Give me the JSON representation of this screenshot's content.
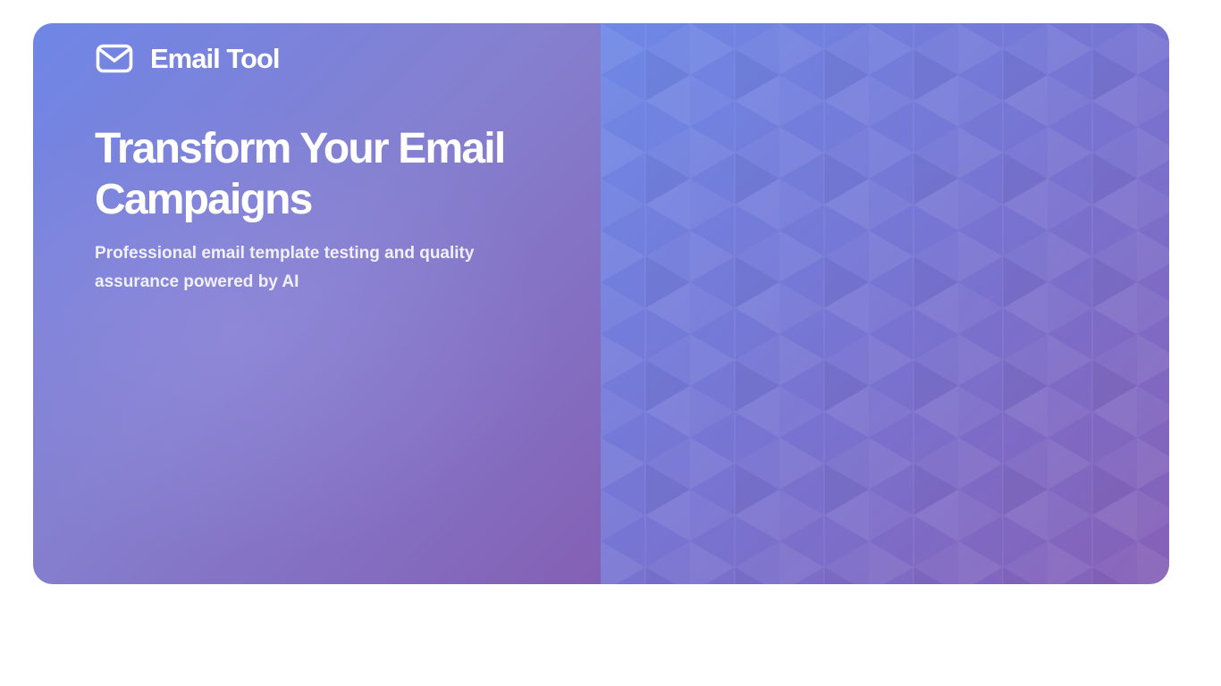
{
  "brand": {
    "name": "Email Tool",
    "icon": "mail-icon"
  },
  "hero": {
    "headline": "Transform Your Email Campaigns",
    "subtitle": "Professional email template testing and quality assurance powered by AI"
  },
  "colors": {
    "gradient_start": "#6f86e6",
    "gradient_mid": "#8580d0",
    "gradient_end": "#8460b4",
    "text": "#ffffff"
  }
}
